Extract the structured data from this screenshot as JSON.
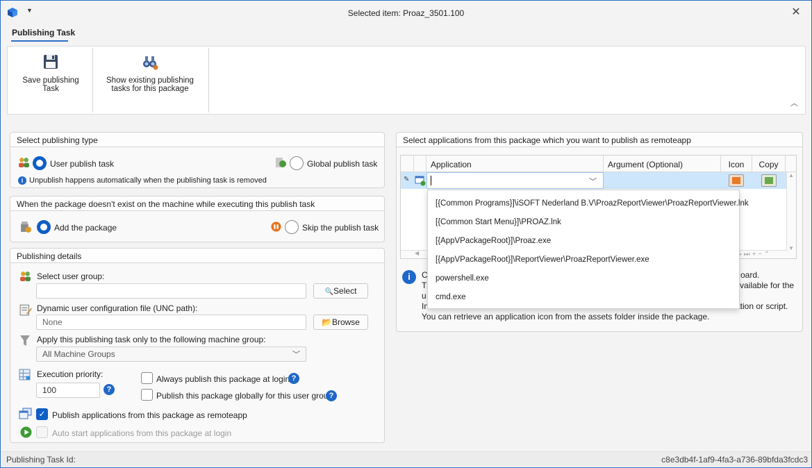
{
  "window": {
    "title": "Selected item: Proaz_3501.100",
    "close_glyph": "✕"
  },
  "ribbon": {
    "tab": "Publishing Task",
    "save_line1": "Save publishing",
    "save_line2": "Task",
    "show_line1": "Show existing publishing",
    "show_line2": "tasks for this package"
  },
  "publishing_type": {
    "header": "Select publishing type",
    "user_task": "User publish task",
    "global_task": "Global publish task",
    "note": "Unpublish happens automatically when the publishing task is removed",
    "selected": "User publish task"
  },
  "missing_package": {
    "header": "When the package doesn't exist on the machine while executing this publish task",
    "add": "Add the package",
    "skip": "Skip the publish task",
    "selected": "Add the package"
  },
  "details": {
    "header": "Publishing details",
    "user_group_label": "Select user group:",
    "user_group_value": "",
    "select_button": "Select",
    "dyn_config_label": "Dynamic user configuration file (UNC path):",
    "dyn_config_placeholder": "None",
    "browse_button": "Browse",
    "machine_group_label": "Apply this publishing task only to the following machine group:",
    "machine_group_value": "All Machine Groups",
    "priority_label": "Execution priority:",
    "priority_value": "100",
    "always_publish": "Always publish this package at login",
    "publish_globally": "Publish this package globally for this user group",
    "publish_remoteapp": "Publish applications from this package as remoteapp",
    "auto_start": "Auto start applications from this package at login",
    "always_publish_checked": false,
    "publish_globally_checked": false,
    "publish_remoteapp_checked": true,
    "auto_start_checked": false
  },
  "apps": {
    "header": "Select applications from this package which you want to publish as remoteapp",
    "columns": [
      "Application",
      "Argument (Optional)",
      "Icon",
      "Copy"
    ],
    "dropdown_items": [
      "[{Common Programs}]\\iSOFT Nederland B.V\\ProazReportViewer\\ProazReportViewer.lnk",
      "[{Common Start Menu}]\\PROAZ.lnk",
      "[{AppVPackageRoot}]\\Proaz.exe",
      "[{AppVPackageRoot}]\\ReportViewer\\ProazReportViewer.exe",
      "powershell.exe",
      "cmd.exe"
    ],
    "nav_glyphs": "▸ ⏭ + − ⌃",
    "info_line1_a": "C",
    "info_line1_b": "oard.",
    "info_line2_a": "T",
    "info_line2_b": "vailable for the",
    "info_line3_a": "u",
    "info_line4_a": "In",
    "info_line4_b": "ation or script.",
    "info_line5": "You can retrieve an application icon from the assets folder inside the package."
  },
  "status": {
    "label": "Publishing Task Id:",
    "id": "c8e3db4f-1af9-4fa3-a736-89bfda3fcdc3"
  },
  "colors": {
    "accent": "#0f5ec5",
    "selection": "#cde6fb"
  }
}
